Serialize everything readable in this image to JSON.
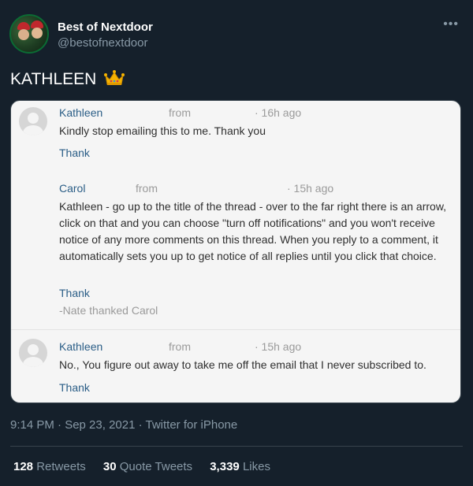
{
  "tweet": {
    "display_name": "Best of Nextdoor",
    "handle": "@bestofnextdoor",
    "text": "KATHLEEN",
    "more_icon": "more-icon",
    "timestamp": "9:14 PM · Sep 23, 2021 · Twitter for iPhone",
    "stats": {
      "retweets_count": "128",
      "retweets_label": "Retweets",
      "quotes_count": "30",
      "quotes_label": "Quote Tweets",
      "likes_count": "3,339",
      "likes_label": "Likes"
    }
  },
  "comments": [
    {
      "author": "Kathleen",
      "from": "from",
      "time": "· 16h ago",
      "text": "Kindly stop emailing this to me. Thank you",
      "thank": "Thank"
    },
    {
      "author": "Carol",
      "from": "from",
      "time": "· 15h ago",
      "text": "Kathleen - go up to the title of the thread - over to the far right there is an arrow, click on that and you can choose \"turn off notifications\" and you won't receive notice of any more comments on this thread. When you reply to a comment, it automatically sets you up to get notice of all replies until you click that choice.",
      "thank": "Thank",
      "thanked": "-Nate thanked Carol"
    },
    {
      "author": "Kathleen",
      "from": "from",
      "time": "· 15h ago",
      "text": "No., You figure out away to take me off the email that I never subscribed to.",
      "thank": "Thank"
    }
  ],
  "colors": {
    "background": "#15202b",
    "link": "#2a5d86",
    "muted": "#8899a6"
  }
}
